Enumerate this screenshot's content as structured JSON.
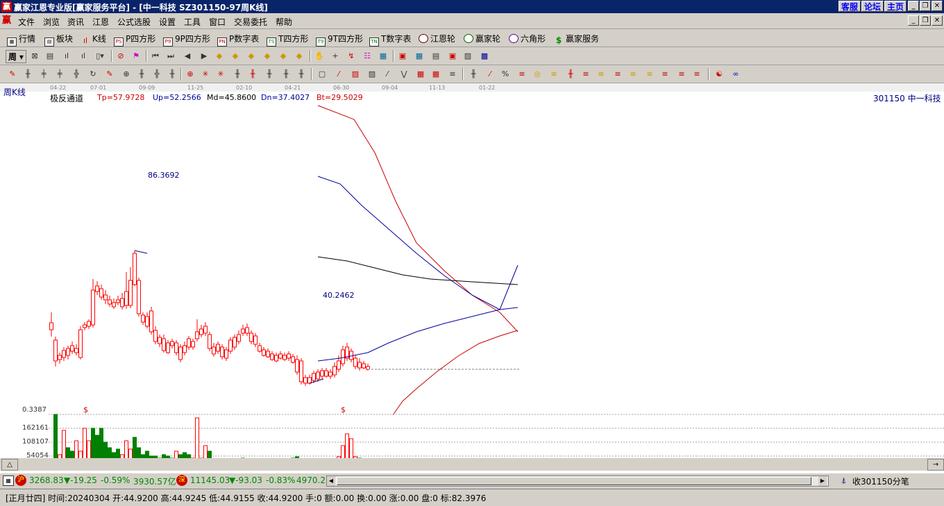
{
  "window": {
    "title": "赢家江恩专业版[赢家服务平台] - [中一科技   SZ301150-97周K线]",
    "logo": "赢",
    "top_buttons": [
      "客服",
      "论坛",
      "主页"
    ]
  },
  "menu": {
    "logo": "赢",
    "items": [
      "文件",
      "浏览",
      "资讯",
      "江恩",
      "公式选股",
      "设置",
      "工具",
      "窗口",
      "交易委托",
      "帮助"
    ]
  },
  "toolbar1": {
    "items": [
      {
        "label": "行情",
        "icon": "grid-icon"
      },
      {
        "label": "板块",
        "icon": "blocks-icon"
      },
      {
        "label": "K线",
        "icon": "candles-icon"
      },
      {
        "label": "P四方形",
        "icon": "ps-icon",
        "badge": "PS"
      },
      {
        "label": "9P四方形",
        "icon": "p9-icon",
        "badge": "P9"
      },
      {
        "label": "P数字表",
        "icon": "pn-icon",
        "badge": "PN"
      },
      {
        "label": "T四方形",
        "icon": "ts-icon",
        "badge": "TS"
      },
      {
        "label": "9T四方形",
        "icon": "t9-icon",
        "badge": "T9"
      },
      {
        "label": "T数字表",
        "icon": "tn-icon",
        "badge": "TN"
      },
      {
        "label": "江恩轮",
        "icon": "gann-wheel-icon"
      },
      {
        "label": "赢家轮",
        "icon": "winner-wheel-icon"
      },
      {
        "label": "六角形",
        "icon": "hexagon-icon"
      },
      {
        "label": "赢家服务",
        "icon": "dollar-icon"
      }
    ]
  },
  "toolbar2": {
    "period_label": "周"
  },
  "chart": {
    "period_label": "周K线",
    "time_axis": [
      "04-22",
      "07-01",
      "09-09",
      "11-25",
      "02-10",
      "04-21",
      "06-30",
      "09-04",
      "11-13",
      "01-22"
    ],
    "indicator": {
      "name": "极反通道",
      "tp": "Tp=57.9728",
      "up": "Up=52.2566",
      "md": "Md=45.8600",
      "dn": "Dn=37.4027",
      "bt": "Bt=29.5029"
    },
    "stock_label": "301150  中一科技",
    "high_label": "86.3692",
    "low_label": "40.2462",
    "volume_labels": [
      "0.3387",
      "162161",
      "108107",
      "54054"
    ],
    "dollar_marks": [
      "$",
      "$"
    ],
    "colors": {
      "up": "#ff0000",
      "down": "#008000",
      "tp": "#cc0000",
      "up_line": "#000099",
      "md": "#000000",
      "label_blue": "#000080"
    }
  },
  "status": {
    "sh_badge": "沪",
    "sh_index": "3268.83",
    "sh_change": "▼-19.25",
    "sh_pct": "-0.59%",
    "sh_amount": "3930.57亿",
    "sz_badge": "深",
    "sz_index": "11145.03",
    "sz_change": "▼-93.03",
    "sz_pct": "-0.83%",
    "sz_amount": "4970.2",
    "right_text": "收301150分笔"
  },
  "info": {
    "text": "[正月廿四] 时间:20240304 开:44.9200 高:44.9245 低:44.9155 收:44.9200 手:0 额:0.00 换:0.00 涨:0.00 盘:0 标:82.3976"
  }
}
